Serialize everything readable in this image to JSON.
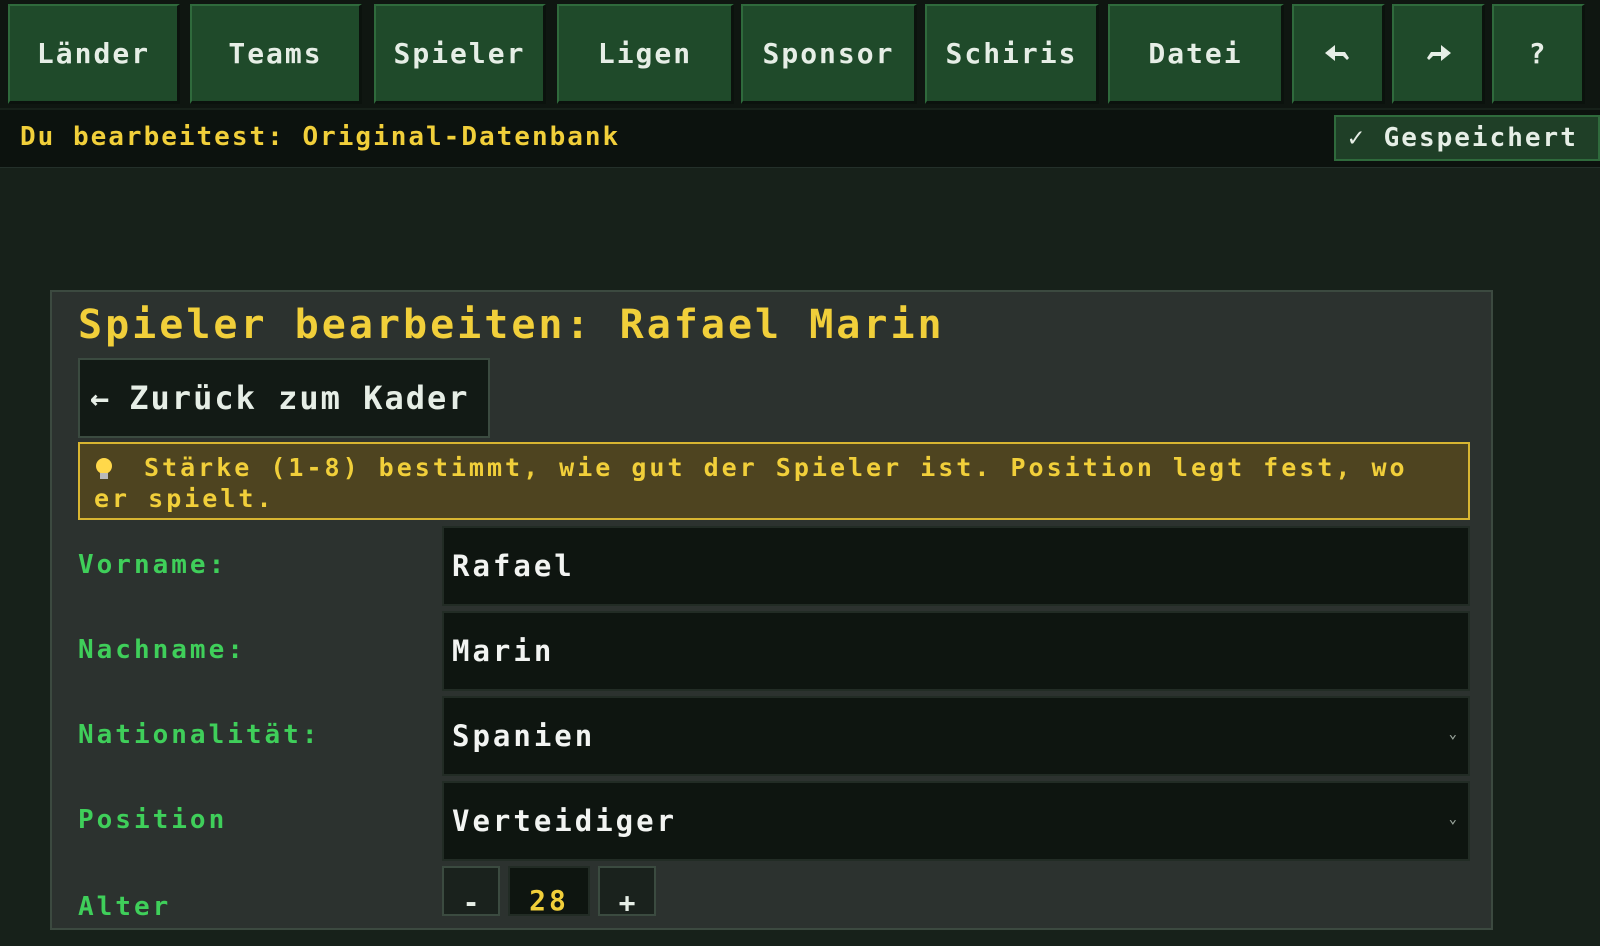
{
  "nav": {
    "laender": "Länder",
    "teams": "Teams",
    "spieler": "Spieler",
    "ligen": "Ligen",
    "sponsor": "Sponsor",
    "schiris": "Schiris",
    "datei": "Datei",
    "undo_icon": "undo-icon",
    "redo_icon": "redo-icon",
    "help": "?"
  },
  "status": {
    "editing": "Du bearbeitest: Original-Datenbank",
    "check": "✓",
    "saved": "Gespeichert"
  },
  "editor": {
    "title": "Spieler bearbeiten: Rafael Marin",
    "back_arrow": "←",
    "back_label": "Zurück zum Kader",
    "hint": "Stärke (1-8) bestimmt, wie gut der Spieler ist. Position legt fest, wo er spielt.",
    "fields": {
      "vorname_label": "Vorname:",
      "vorname_value": "Rafael",
      "nachname_label": "Nachname:",
      "nachname_value": "Marin",
      "nationalitaet_label": "Nationalität:",
      "nationalitaet_value": "Spanien",
      "position_label": "Position",
      "position_value": "Verteidiger",
      "alter_label": "Alter",
      "alter_value": "28",
      "minus": "-",
      "plus": "+"
    }
  },
  "colors": {
    "accent_yellow": "#f1cf3a",
    "label_green": "#3fcf5a",
    "nav_green": "#1f4a2a",
    "background": "#17211a"
  }
}
